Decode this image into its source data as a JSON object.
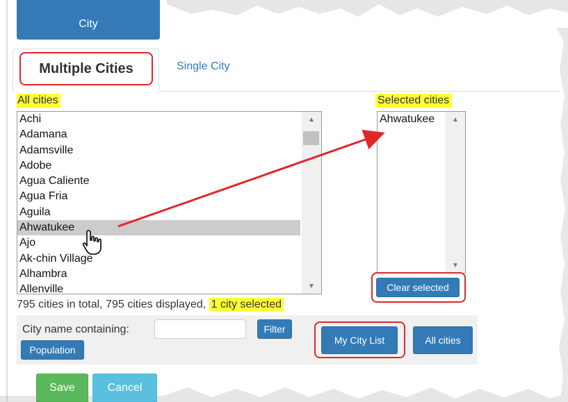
{
  "top_button": {
    "label": "City"
  },
  "tabs": {
    "active": "Multiple Cities",
    "inactive": "Single City"
  },
  "all_cities": {
    "label": "All cities",
    "items": [
      "Achi",
      "Adamana",
      "Adamsville",
      "Adobe",
      "Agua Caliente",
      "Agua Fria",
      "Aguila",
      "Ahwatukee",
      "Ajo",
      "Ak-chin Village",
      "Alhambra",
      "Allenville"
    ],
    "selected_item": "Ahwatukee"
  },
  "selected_cities": {
    "label": "Selected cities",
    "items": [
      "Ahwatukee"
    ],
    "clear_button": "Clear selected"
  },
  "summary": {
    "text": "795 cities in total, 795 cities displayed,",
    "selected_text": "1 city selected"
  },
  "filter": {
    "label": "City name containing:",
    "input_value": "",
    "input_placeholder": "",
    "filter_button": "Filter",
    "population_button": "Population",
    "my_city_list_button": "My City List",
    "all_cities_button": "All cities"
  },
  "footer": {
    "save_button": "Save",
    "cancel_button": "Cancel"
  },
  "colors": {
    "primary": "#337ab7",
    "highlight": "#ffff33",
    "annotation_red": "#e0262b",
    "success": "#5cb85c",
    "info": "#5bc0de"
  }
}
